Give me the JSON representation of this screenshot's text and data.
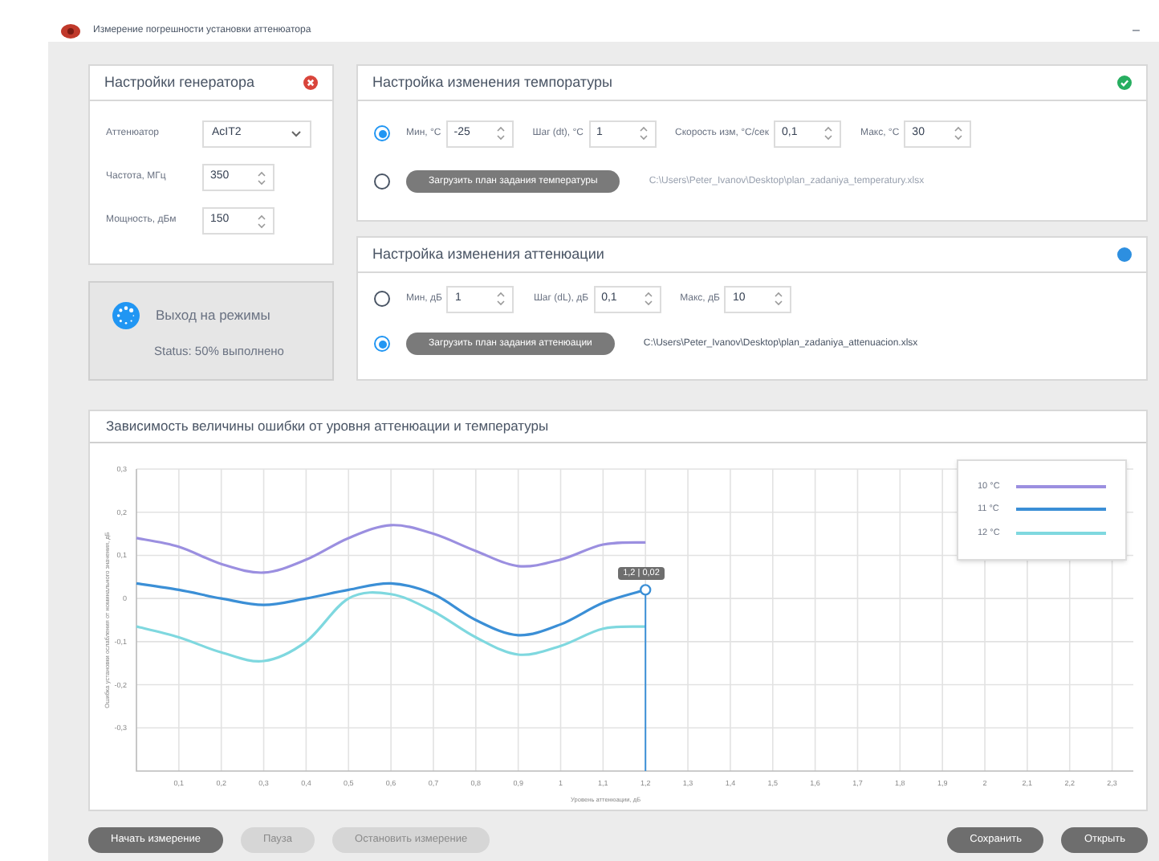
{
  "window": {
    "title": "Измерение погрешности установки аттенюатора",
    "controls": [
      "–"
    ]
  },
  "generator": {
    "title": "Настройки генератора",
    "error": true,
    "done": false,
    "fields": [
      {
        "label": "Аттенюатор",
        "kind": "select",
        "value": "AcIT2"
      },
      {
        "label": "Частота, МГц",
        "kind": "spin",
        "value": "350"
      },
      {
        "label": "Мощность, дБм",
        "kind": "spin",
        "value": "150"
      }
    ]
  },
  "progress": {
    "title": "Выход на режимы",
    "status_text": "Status: 50% выполнено"
  },
  "temperature": {
    "title": "Настройка изменения темпоратуры",
    "error": false,
    "done": true,
    "modes": [
      {
        "selected": true,
        "kind": "fields",
        "fields": [
          {
            "label": "Мин, °С",
            "value": "-25"
          },
          {
            "label": "Шаг (dt), °С",
            "value": "1"
          },
          {
            "label": "Скорость изм, °С/сек",
            "value": "0,1"
          },
          {
            "label": "Макс, °С",
            "value": "30"
          }
        ]
      },
      {
        "selected": false,
        "kind": "file",
        "button": "Загрузить план задания температуры",
        "path": "C:\\Users\\Peter_Ivanov\\Desktop\\plan_zadaniya_temperatury.xlsx"
      }
    ]
  },
  "attenuation": {
    "title": "Настройка изменения аттенюации",
    "error": false,
    "done": false,
    "modes": [
      {
        "selected": false,
        "kind": "fields",
        "fields": [
          {
            "label": "Мин, дБ",
            "value": "1"
          },
          {
            "label": "Шаг (dL), дБ",
            "value": "0,1"
          },
          {
            "label": "Макс, дБ",
            "value": "10"
          }
        ]
      },
      {
        "selected": true,
        "kind": "file",
        "button": "Загрузить план задания аттенюации",
        "path": "C:\\Users\\Peter_Ivanov\\Desktop\\plan_zadaniya_attenuacion.xlsx"
      }
    ]
  },
  "chart": {
    "title": "Зависимость величины ошибки от уровня аттенюации и температуры",
    "chart_data": {
      "type": "line",
      "xlabel": "Уровень аттенюации, дБ",
      "ylabel": "Ошибка установки ослабления от номинального значения, дБ",
      "x": [
        0,
        0.1,
        0.2,
        0.3,
        0.4,
        0.5,
        0.6,
        0.7,
        0.8,
        0.9,
        1,
        1.1,
        1.2
      ],
      "series": [
        {
          "name": "10 °C",
          "color": "#9b8fe0",
          "values": [
            0.14,
            0.12,
            0.08,
            0.06,
            0.09,
            0.14,
            0.17,
            0.15,
            0.11,
            0.075,
            0.09,
            0.125,
            0.13
          ]
        },
        {
          "name": "11 °C",
          "color": "#3b8fd6",
          "values": [
            0.035,
            0.02,
            0,
            -0.015,
            0,
            0.02,
            0.035,
            0.01,
            -0.05,
            -0.085,
            -0.06,
            -0.01,
            0.02
          ]
        },
        {
          "name": "12 °C",
          "color": "#7fd8df",
          "values": [
            -0.065,
            -0.09,
            -0.125,
            -0.145,
            -0.1,
            0,
            0.01,
            -0.03,
            -0.09,
            -0.13,
            -0.11,
            -0.07,
            -0.065
          ]
        }
      ],
      "xlim": [
        0,
        2.35
      ],
      "ylim": [
        -0.4,
        0.3
      ],
      "xticks": [
        {
          "value": 0.1,
          "label": "0,1"
        },
        {
          "value": 0.2,
          "label": "0,2"
        },
        {
          "value": 0.3,
          "label": "0,3"
        },
        {
          "value": 0.4,
          "label": "0,4"
        },
        {
          "value": 0.5,
          "label": "0,5"
        },
        {
          "value": 0.6,
          "label": "0,6"
        },
        {
          "value": 0.7,
          "label": "0,7"
        },
        {
          "value": 0.8,
          "label": "0,8"
        },
        {
          "value": 0.9,
          "label": "0,9"
        },
        {
          "value": 1,
          "label": "1"
        },
        {
          "value": 1.1,
          "label": "1,1"
        },
        {
          "value": 1.2,
          "label": "1,2"
        },
        {
          "value": 1.3,
          "label": "1,3"
        },
        {
          "value": 1.4,
          "label": "1,4"
        },
        {
          "value": 1.5,
          "label": "1,5"
        },
        {
          "value": 1.6,
          "label": "1,6"
        },
        {
          "value": 1.7,
          "label": "1,7"
        },
        {
          "value": 1.8,
          "label": "1,8"
        },
        {
          "value": 1.9,
          "label": "1,9"
        },
        {
          "value": 2,
          "label": "2"
        },
        {
          "value": 2.1,
          "label": "2,1"
        },
        {
          "value": 2.2,
          "label": "2,2"
        },
        {
          "value": 2.3,
          "label": "2,3"
        }
      ],
      "yticks": [
        {
          "value": 0.3,
          "label": "0,3"
        },
        {
          "value": 0.2,
          "label": "0,2"
        },
        {
          "value": 0.1,
          "label": "0,1"
        },
        {
          "value": 0,
          "label": "0"
        },
        {
          "value": -0.1,
          "label": "-0,1"
        },
        {
          "value": -0.2,
          "label": "-0,2"
        },
        {
          "value": -0.3,
          "label": "-0,3"
        }
      ],
      "grid": true,
      "annotations": [
        {
          "x": 1.2,
          "y": 0.02,
          "text": "1,2 | 0,02"
        }
      ]
    }
  },
  "buttons_left": [
    {
      "label": "Начать измерение",
      "disabled": false
    },
    {
      "label": "Пауза",
      "disabled": true
    },
    {
      "label": "Остановить измерение",
      "disabled": true
    }
  ],
  "buttons_right": [
    {
      "label": "Сохранить",
      "disabled": false
    },
    {
      "label": "Открыть",
      "disabled": false
    }
  ]
}
